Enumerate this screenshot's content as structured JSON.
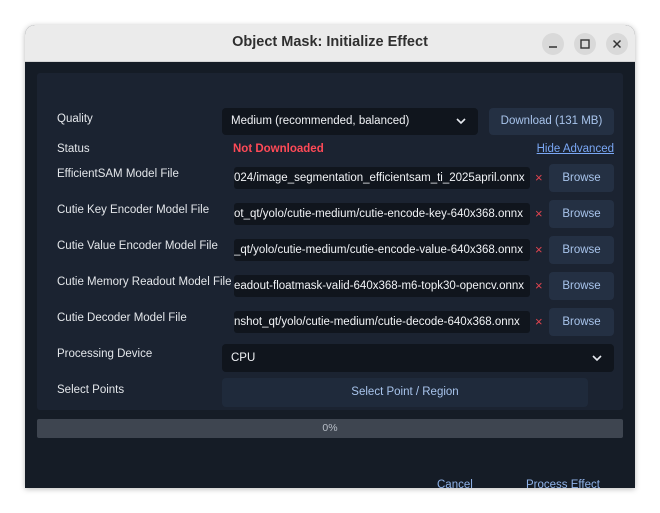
{
  "window": {
    "title": "Object Mask: Initialize Effect",
    "controls": [
      "minimize-icon",
      "maximize-icon",
      "close-icon"
    ]
  },
  "quality": {
    "label": "Quality",
    "selected": "Medium (recommended, balanced)",
    "download_label": "Download (131 MB)"
  },
  "status": {
    "label": "Status",
    "value": "Not Downloaded",
    "value_color": "#ff4a57",
    "toggle_link": "Hide Advanced"
  },
  "models": [
    {
      "label": "EfficientSAM Model File",
      "path": "024/image_segmentation_efficientsam_ti_2025april.onnx",
      "browse": "Browse"
    },
    {
      "label": "Cutie Key Encoder Model File",
      "path": "ot_qt/yolo/cutie-medium/cutie-encode-key-640x368.onnx",
      "browse": "Browse"
    },
    {
      "label": "Cutie Value Encoder Model File",
      "path": "_qt/yolo/cutie-medium/cutie-encode-value-640x368.onnx",
      "browse": "Browse"
    },
    {
      "label": "Cutie Memory Readout Model File",
      "path": "eadout-floatmask-valid-640x368-m6-topk30-opencv.onnx",
      "browse": "Browse"
    },
    {
      "label": "Cutie Decoder Model File",
      "path": "nshot_qt/yolo/cutie-medium/cutie-decode-640x368.onnx",
      "browse": "Browse"
    }
  ],
  "clear_symbol": "×",
  "device": {
    "label": "Processing Device",
    "selected": "CPU"
  },
  "points": {
    "label": "Select Points",
    "button": "Select Point / Region"
  },
  "progress": {
    "value": 0,
    "text": "0%"
  },
  "footer": {
    "cancel": "Cancel",
    "process": "Process Effect"
  },
  "colors": {
    "accent": "#7aa7f4",
    "danger": "#e0444f",
    "background": "#151c26"
  }
}
